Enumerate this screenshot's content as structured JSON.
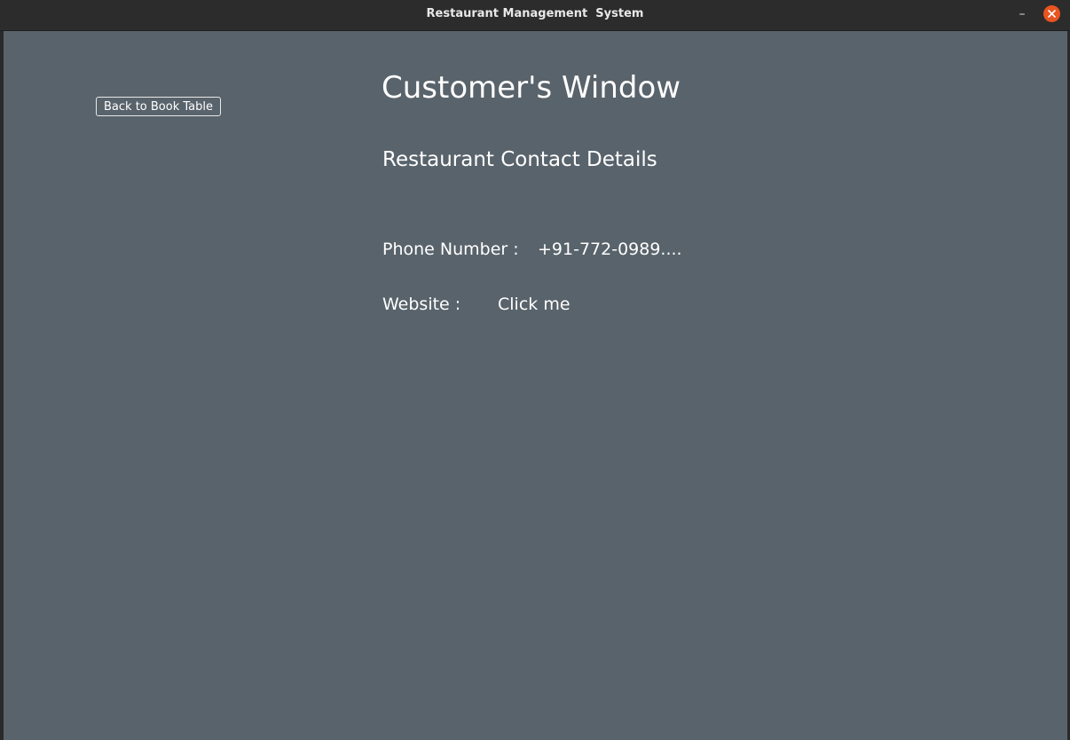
{
  "window": {
    "title": "Restaurant Management  System",
    "minimize_glyph": "–",
    "close_icon": "close-icon",
    "close_color": "#e95420"
  },
  "content": {
    "background": "#59636b",
    "back_button_label": "Back to Book Table",
    "heading": "Customer's Window",
    "subheading": "Restaurant Contact Details",
    "phone": {
      "label": "Phone Number :",
      "value": "+91-772-0989...."
    },
    "website": {
      "label": "Website :",
      "link_text": "Click me"
    }
  }
}
